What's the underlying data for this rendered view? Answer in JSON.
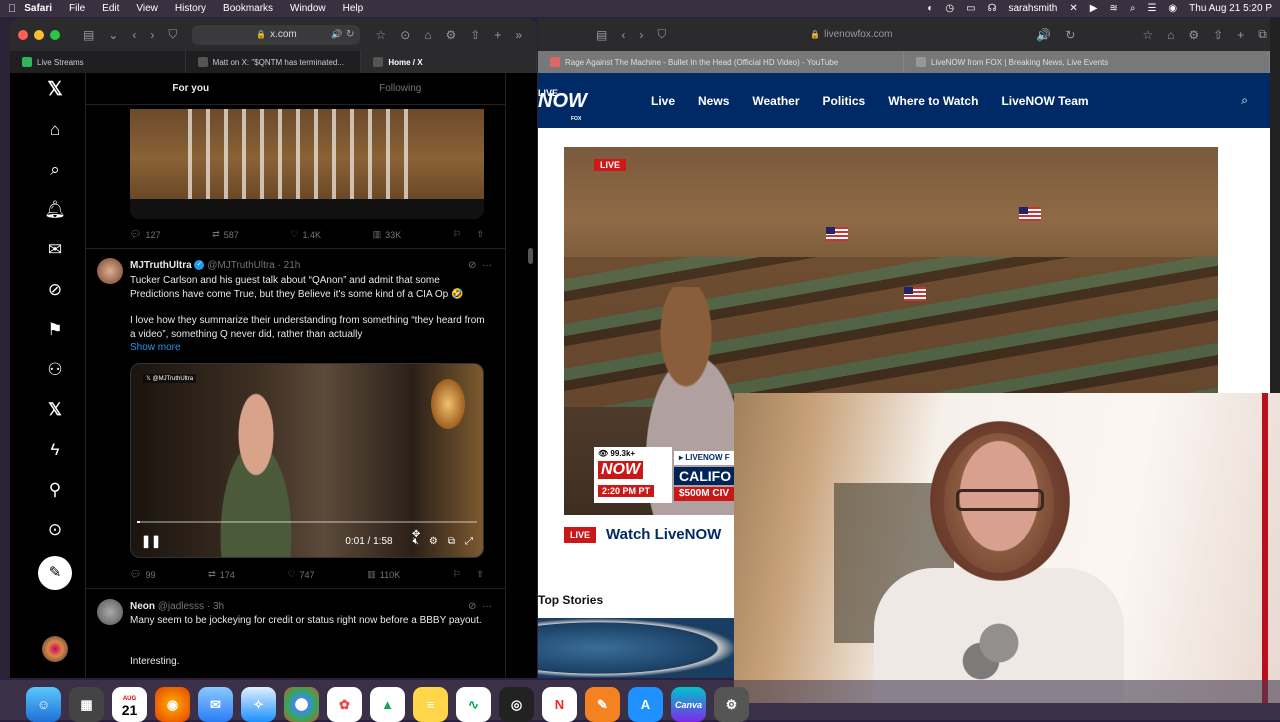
{
  "menubar": {
    "apple": "",
    "items": [
      "Safari",
      "File",
      "Edit",
      "View",
      "History",
      "Bookmarks",
      "Window",
      "Help"
    ],
    "user": "sarahsmith",
    "clock": "Thu Aug 21  5:20 P"
  },
  "left_window": {
    "url": "x.com",
    "tabs": [
      "Live Streams",
      "Matt on X: \"$QNTM has terminated...",
      "Home / X"
    ],
    "feed_tabs": [
      "For you",
      "Following"
    ],
    "tweet0_actions": {
      "replies": "127",
      "reposts": "587",
      "likes": "1.4K",
      "views": "33K"
    },
    "tweet1": {
      "name": "MJTruthUltra",
      "handle": "@MJTruthUltra · 21h",
      "text1": "Tucker Carlson and his guest talk about “QAnon” and admit that some Predictions have come True, but they Believe it's some kind of a CIA Op 🤣",
      "text2": "I love how they summarize their understanding from something “they heard from a video”, something Q never did, rather than actually",
      "show_more": "Show more",
      "video_watermark": "𝕏 @MJTruthUltra",
      "video_time": "0:01 / 1:58",
      "video_progress": 0.01,
      "actions": {
        "replies": "99",
        "reposts": "174",
        "likes": "747",
        "views": "110K"
      }
    },
    "tweet2": {
      "name": "Neon",
      "handle": "@jadlesss · 3h",
      "text1": "Many seem to be jockeying for credit or status right now before a BBBY payout.",
      "text2": "Interesting."
    }
  },
  "right_window": {
    "url": "livenowfox.com",
    "tabs": [
      "Rage Against The Machine - Bullet In the Head (Official HD Video) - YouTube",
      "LiveNOW from FOX | Breaking News, Live Events"
    ],
    "logo": {
      "l1": "LIVE",
      "l2": "NOW",
      "l3": "FOX"
    },
    "nav": [
      "Live",
      "News",
      "Weather",
      "Politics",
      "Where to Watch",
      "LiveNOW Team"
    ],
    "live_badge": "LIVE",
    "lower_third": {
      "viewers": "👁 99.3k+",
      "tag": "▸ LIVENOW F",
      "now": "NOW",
      "time": "2:20 PM PT",
      "headline": "CALIFO",
      "sub": "$500M CIV"
    },
    "watch_badge": "LIVE",
    "watch_text": "Watch LiveNOW",
    "top_stories": "Top Stories"
  },
  "dock": {
    "date_month": "AUG",
    "date_day": "21",
    "canva": "Canva"
  }
}
